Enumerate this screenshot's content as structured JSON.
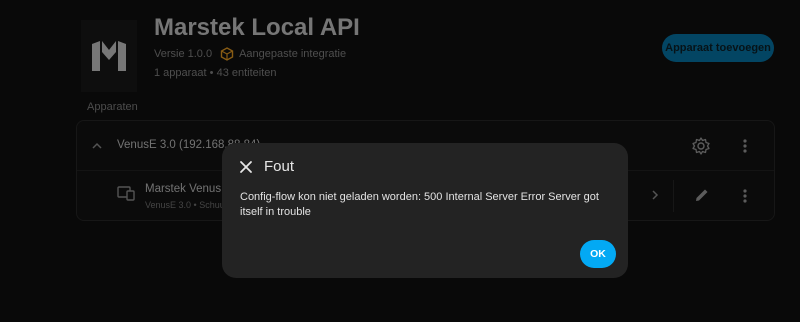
{
  "integration": {
    "title": "Marstek Local API",
    "version": "Versie 1.0.0",
    "custom_label": "Aangepaste integratie",
    "devices_link": "1 apparaat",
    "separator": " • ",
    "entities_link": "43 entiteiten",
    "logo_icon": "marstek-logo-icon",
    "custom_icon": "package-icon"
  },
  "actions": {
    "add_device": "Apparaat toevoegen"
  },
  "devices_section": {
    "label": "Apparaten",
    "group": {
      "label": "VenusE 3.0 (192.168.88.84)"
    },
    "device": {
      "name": "Marstek Venus E3",
      "subtitle": "VenusE 3.0 • Schuur"
    }
  },
  "dialog": {
    "title": "Fout",
    "message": "Config-flow kon niet geladen worden: 500 Internal Server Error Server got itself in trouble",
    "ok_label": "OK"
  },
  "colors": {
    "accent": "#03a9f4",
    "custom_icon": "#f9a825",
    "background": "#111111",
    "dialog_bg": "#232323"
  }
}
